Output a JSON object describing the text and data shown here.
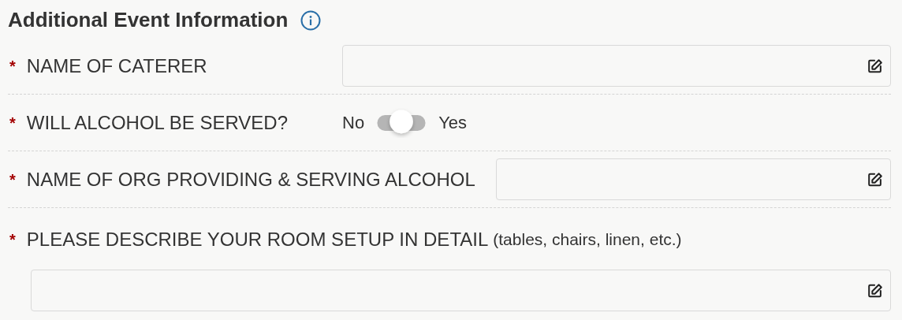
{
  "section": {
    "title": "Additional Event Information"
  },
  "fields": [
    {
      "kind": "text",
      "required_mark": "*",
      "label": "NAME OF CATERER"
    },
    {
      "kind": "toggle",
      "required_mark": "*",
      "label": "WILL ALCOHOL BE SERVED?",
      "options": [
        {
          "label": "No",
          "selected": false
        },
        {
          "label": "Yes",
          "selected": false
        }
      ]
    },
    {
      "kind": "text",
      "required_mark": "*",
      "label": "NAME OF ORG PROVIDING & SERVING ALCOHOL"
    },
    {
      "kind": "stacked",
      "required_mark": "*",
      "label": "PLEASE DESCRIBE YOUR ROOM SETUP IN DETAIL",
      "hint": "(tables, chairs, linen, etc.)"
    }
  ]
}
